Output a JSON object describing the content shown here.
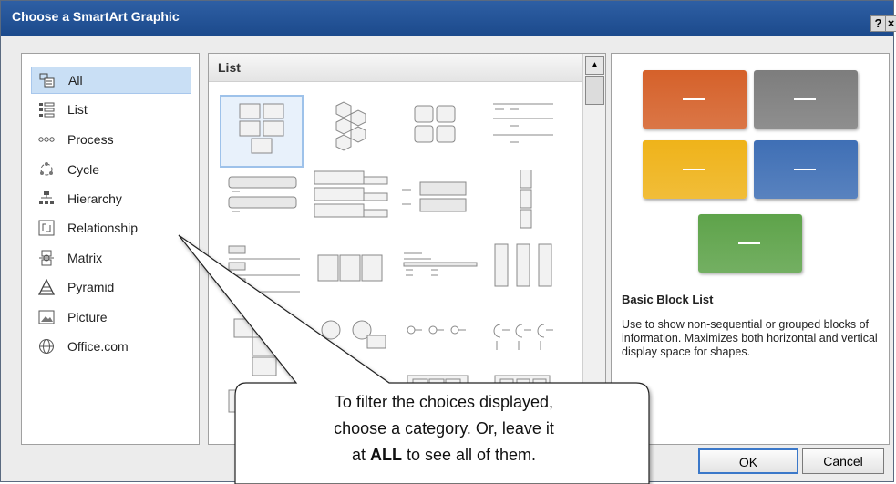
{
  "dialog": {
    "title": "Choose a SmartArt Graphic",
    "help_label": "?",
    "close_label": "×"
  },
  "categories": [
    {
      "label": "All",
      "icon": "all-icon",
      "selected": true
    },
    {
      "label": "List",
      "icon": "list-icon"
    },
    {
      "label": "Process",
      "icon": "process-icon"
    },
    {
      "label": "Cycle",
      "icon": "cycle-icon"
    },
    {
      "label": "Hierarchy",
      "icon": "hierarchy-icon"
    },
    {
      "label": "Relationship",
      "icon": "relationship-icon"
    },
    {
      "label": "Matrix",
      "icon": "matrix-icon"
    },
    {
      "label": "Pyramid",
      "icon": "pyramid-icon"
    },
    {
      "label": "Picture",
      "icon": "picture-icon"
    },
    {
      "label": "Office.com",
      "icon": "globe-icon"
    }
  ],
  "gallery": {
    "section_label": "List"
  },
  "preview": {
    "colors": [
      "#d5612a",
      "#7d7d7d",
      "#efb31a",
      "#3f6fb5",
      "#5ea34a"
    ],
    "title": "Basic Block List",
    "description": "Use to show non-sequential or grouped blocks of information. Maximizes both horizontal and vertical display space for shapes."
  },
  "buttons": {
    "ok": "OK",
    "cancel": "Cancel"
  },
  "callout": {
    "line1": "To filter the choices displayed,",
    "line2": "choose a category. Or, leave it",
    "line3_pre": "at ",
    "line3_bold": "ALL",
    "line3_post": " to see all of them."
  }
}
